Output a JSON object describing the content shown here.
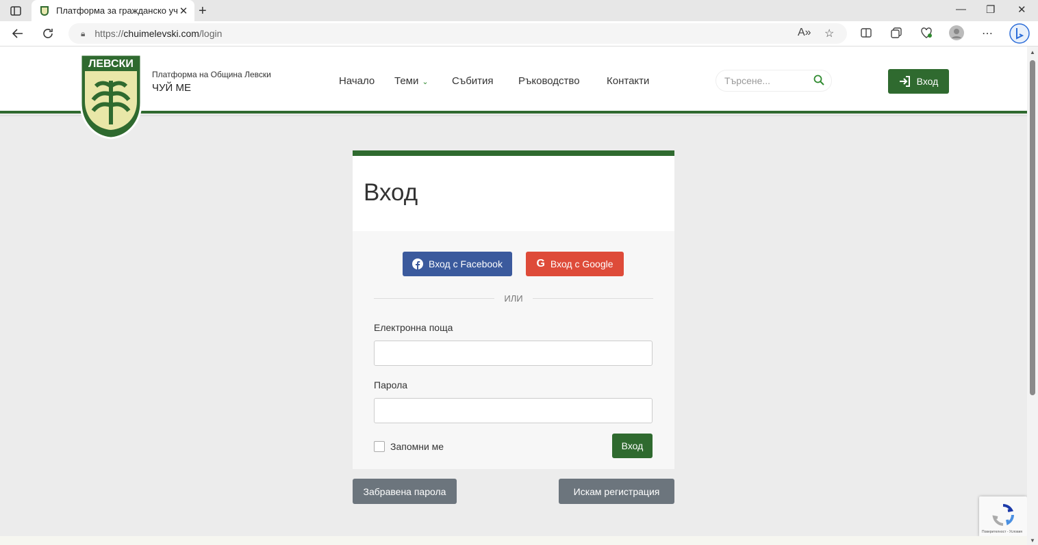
{
  "browser": {
    "tab_title": "Платформа за гражданско учас",
    "tab_close": "✕",
    "new_tab": "+",
    "url_scheme": "https://",
    "url_host": "chuimelevski.com",
    "url_path": "/login",
    "window_controls": [
      "—",
      "❐",
      "✕"
    ]
  },
  "header": {
    "logo_text": "ЛЕВСКИ",
    "brand_subtitle": "Платформа на Община Левски",
    "brand_title": "ЧУЙ МЕ",
    "menu": [
      "Начало",
      "Теми",
      "Събития",
      "Ръководство",
      "Контакти"
    ],
    "search_placeholder": "Търсене...",
    "login_label": "Вход"
  },
  "login_card": {
    "title": "Вход",
    "facebook_label": "Вход с Facebook",
    "google_label": "Вход с Google",
    "or_text": "ИЛИ",
    "email_label": "Електронна поща",
    "email_value": "",
    "password_label": "Парола",
    "password_value": "",
    "remember_label": "Запомни ме",
    "remember_checked": false,
    "submit_label": "Вход"
  },
  "links": {
    "forgot_password": "Забравена парола",
    "register": "Искам регистрация"
  },
  "recaptcha": {
    "footer_text": "Поверителност - Условия"
  },
  "colors": {
    "brand_green": "#2f6a2f",
    "facebook": "#3b5a9d",
    "google": "#de4b39",
    "secondary": "#6c757d"
  }
}
